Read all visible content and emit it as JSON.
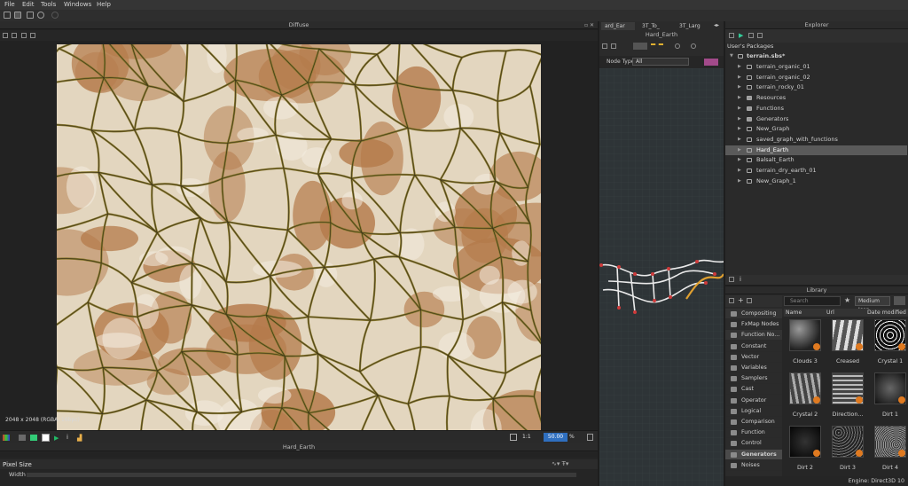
{
  "menu": {
    "file": "File",
    "edit": "Edit",
    "tools": "Tools",
    "windows": "Windows",
    "help": "Help"
  },
  "viewport2d": {
    "title": "Diffuse",
    "resolution_info": "2048 x 2048 (RGBA, 16bpc)",
    "zoom_value": "50.00",
    "zoom_unit": "%",
    "ratio_label": "1:1"
  },
  "graph": {
    "tabs": [
      "ard_Ear",
      "3T_To_",
      "3T_Larg"
    ],
    "title": "Hard_Earth",
    "node_type_label": "Node Type",
    "node_type_value": "All"
  },
  "explorer": {
    "title": "Explorer",
    "root_label": "User's Packages",
    "package": "terrain.sbs*",
    "items": [
      "terrain_organic_01",
      "terrain_organic_02",
      "terrain_rocky_01",
      "Resources",
      "Functions",
      "Generators",
      "New_Graph",
      "saved_graph_with_functions",
      "Hard_Earth",
      "Balsalt_Earth",
      "terrain_dry_earth_01",
      "New_Graph_1"
    ],
    "selected": "Hard_Earth"
  },
  "library": {
    "title": "Library",
    "search_placeholder": "Search",
    "view_mode": "Medium Icon",
    "columns": {
      "name": "Name",
      "url": "Url",
      "date": "Date modified"
    },
    "categories": [
      "Compositing ...",
      "FxMap Nodes",
      "Function No...",
      "Constant",
      "Vector",
      "Variables",
      "Samplers",
      "Cast",
      "Operator",
      "Logical",
      "Comparison",
      "Function",
      "Control",
      "Generators",
      "Noises"
    ],
    "selected_category": "Generators",
    "thumbs": [
      "Clouds 3",
      "Creased",
      "Crystal 1",
      "Crystal 2",
      "Direction...",
      "Dirt 1",
      "Dirt 2",
      "Dirt 3",
      "Dirt 4"
    ]
  },
  "properties": {
    "title": "Hard_Earth",
    "section": "Pixel Size",
    "field_label": "Width"
  },
  "status": {
    "engine": "Engine: Direct3D 10"
  },
  "colors": {
    "accent_blue": "#2f6fbf",
    "selected_row": "#5a5a5a",
    "graph_bg": "#2e3437",
    "texture_base": "#e3d6bf",
    "crack_color": "#8a7a2e",
    "texture_brown": "#b47a4a"
  }
}
